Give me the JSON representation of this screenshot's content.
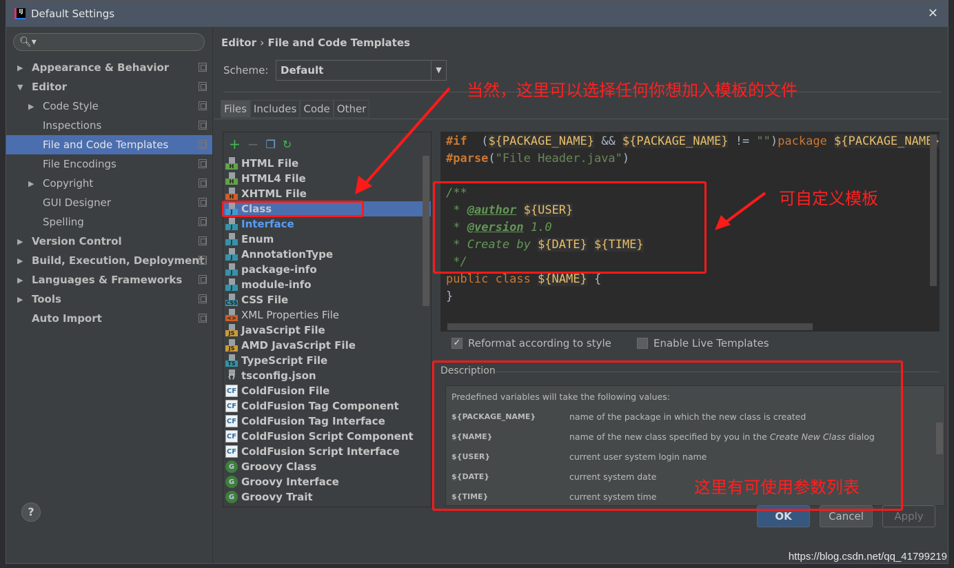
{
  "window": {
    "title": "Default Settings"
  },
  "search": {
    "placeholder": ""
  },
  "sidebar": {
    "items": [
      {
        "label": "Appearance & Behavior",
        "level": 0,
        "arrow": "▶",
        "bold": true
      },
      {
        "label": "Editor",
        "level": 0,
        "arrow": "▼",
        "bold": true
      },
      {
        "label": "Code Style",
        "level": 1,
        "arrow": "▶"
      },
      {
        "label": "Inspections",
        "level": 1,
        "arrow": ""
      },
      {
        "label": "File and Code Templates",
        "level": 1,
        "arrow": "",
        "selected": true
      },
      {
        "label": "File Encodings",
        "level": 1,
        "arrow": ""
      },
      {
        "label": "Copyright",
        "level": 1,
        "arrow": "▶"
      },
      {
        "label": "GUI Designer",
        "level": 1,
        "arrow": ""
      },
      {
        "label": "Spelling",
        "level": 1,
        "arrow": ""
      },
      {
        "label": "Version Control",
        "level": 0,
        "arrow": "▶",
        "bold": true
      },
      {
        "label": "Build, Execution, Deployment",
        "level": 0,
        "arrow": "▶",
        "bold": true
      },
      {
        "label": "Languages & Frameworks",
        "level": 0,
        "arrow": "▶",
        "bold": true
      },
      {
        "label": "Tools",
        "level": 0,
        "arrow": "▶",
        "bold": true
      },
      {
        "label": "Auto Import",
        "level": 0,
        "arrow": "",
        "bold": true
      }
    ]
  },
  "breadcrumb": {
    "parent": "Editor",
    "sep": "›",
    "current": "File and Code Templates"
  },
  "scheme": {
    "label": "Scheme:",
    "value": "Default"
  },
  "tabs": [
    "Files",
    "Includes",
    "Code",
    "Other"
  ],
  "toolbar": {
    "add": "+",
    "remove": "−"
  },
  "templates": [
    {
      "label": "HTML File",
      "icon": "H",
      "color": "#62a248"
    },
    {
      "label": "HTML4 File",
      "icon": "H",
      "color": "#62a248"
    },
    {
      "label": "XHTML File",
      "icon": "H",
      "color": "#c8602a"
    },
    {
      "label": "Class",
      "icon": "J",
      "color": "#3d9ad6",
      "selected": true
    },
    {
      "label": "Interface",
      "icon": "J",
      "color": "#3592a8",
      "link": true
    },
    {
      "label": "Enum",
      "icon": "J",
      "color": "#3592a8"
    },
    {
      "label": "AnnotationType",
      "icon": "J",
      "color": "#3592a8"
    },
    {
      "label": "package-info",
      "icon": "J",
      "color": "#3592a8"
    },
    {
      "label": "module-info",
      "icon": "J",
      "color": "#3592a8"
    },
    {
      "label": "CSS File",
      "icon": "CSS",
      "color": "#3592a8"
    },
    {
      "label": "XML Properties File",
      "icon": "<>",
      "color": "#c8602a",
      "plain": true
    },
    {
      "label": "JavaScript File",
      "icon": "JS",
      "color": "#c99b3a"
    },
    {
      "label": "AMD JavaScript File",
      "icon": "JS",
      "color": "#c99b3a"
    },
    {
      "label": "TypeScript File",
      "icon": "TS",
      "color": "#3592a8"
    },
    {
      "label": "tsconfig.json",
      "icon": "{}",
      "color": ""
    },
    {
      "label": "ColdFusion File",
      "icon": "CF",
      "type": "cf"
    },
    {
      "label": "ColdFusion Tag Component",
      "icon": "CF",
      "type": "cf"
    },
    {
      "label": "ColdFusion Tag Interface",
      "icon": "CF",
      "type": "cf"
    },
    {
      "label": "ColdFusion Script Component",
      "icon": "CF",
      "type": "cf"
    },
    {
      "label": "ColdFusion Script Interface",
      "icon": "CF",
      "type": "cf"
    },
    {
      "label": "Groovy Class",
      "icon": "G",
      "type": "groovy"
    },
    {
      "label": "Groovy Interface",
      "icon": "G",
      "type": "groovy"
    },
    {
      "label": "Groovy Trait",
      "icon": "G",
      "type": "groovy"
    }
  ],
  "code": {
    "lines": [
      [
        [
          "dir",
          "#if"
        ],
        [
          "",
          "  ("
        ],
        [
          "var",
          "${PACKAGE_NAME}"
        ],
        [
          "",
          " && "
        ],
        [
          "var",
          "${PACKAGE_NAME}"
        ],
        [
          "",
          " != "
        ],
        [
          "str",
          "\"\""
        ],
        [
          "",
          ")"
        ],
        [
          "kw",
          "package"
        ],
        [
          "",
          " "
        ],
        [
          "var",
          "${PACKAGE_NAME}"
        ],
        [
          "",
          ";"
        ]
      ],
      [
        [
          "dir",
          "#parse"
        ],
        [
          "",
          "("
        ],
        [
          "str",
          "\"File Header.java\""
        ],
        [
          "",
          ")"
        ]
      ],
      [],
      [
        [
          "cm",
          "/**"
        ]
      ],
      [
        [
          "cm",
          " * "
        ],
        [
          "tag",
          "@author"
        ],
        [
          "",
          " "
        ],
        [
          "var",
          "${USER}"
        ]
      ],
      [
        [
          "cm",
          " * "
        ],
        [
          "tag",
          "@version"
        ],
        [
          "cm",
          " 1.0"
        ]
      ],
      [
        [
          "cm",
          " * Create by "
        ],
        [
          "var",
          "${DATE}"
        ],
        [
          "",
          " "
        ],
        [
          "var",
          "${TIME}"
        ]
      ],
      [
        [
          "cm",
          " */"
        ]
      ],
      [
        [
          "kw",
          "public class "
        ],
        [
          "var",
          "${NAME}"
        ],
        [
          "",
          " {"
        ]
      ],
      [
        [
          "",
          "}"
        ]
      ]
    ]
  },
  "options": {
    "reformat": {
      "label": "Reformat according to style",
      "checked": true
    },
    "live": {
      "label": "Enable Live Templates",
      "checked": false
    }
  },
  "description": {
    "title": "Description",
    "intro": "Predefined variables will take the following values:",
    "vars": [
      {
        "name": "${PACKAGE_NAME}",
        "text": "name of the package in which the new class is created"
      },
      {
        "name": "${NAME}",
        "text": "name of the new class specified by you in the ",
        "em": "Create New Class",
        "tail": " dialog"
      },
      {
        "name": "${USER}",
        "text": "current user system login name"
      },
      {
        "name": "${DATE}",
        "text": "current system date"
      },
      {
        "name": "${TIME}",
        "text": "current system time"
      }
    ]
  },
  "buttons": {
    "help": "?",
    "ok": "OK",
    "cancel": "Cancel",
    "apply": "Apply"
  },
  "annotations": {
    "choose": "当然，这里可以选择任何你想加入模板的文件",
    "custom": "可自定义模板",
    "params": "这里有可使用参数列表",
    "color": "#ff1a1a"
  },
  "watermark": "https://blog.csdn.net/qq_41799219"
}
